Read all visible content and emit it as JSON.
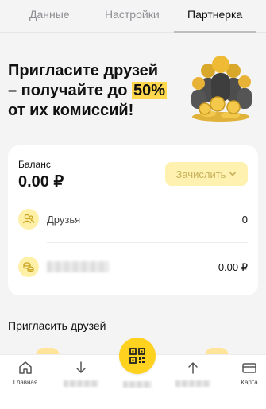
{
  "tabs": [
    {
      "label": "Данные"
    },
    {
      "label": "Настройки"
    },
    {
      "label": "Партнерка",
      "active": true
    }
  ],
  "hero": {
    "title_line1": "Пригласите друзей",
    "title_line2_prefix": "– получайте до ",
    "title_highlight": "50%",
    "title_line3": "от их комиссий!"
  },
  "balance": {
    "label": "Баланс",
    "value": "0.00 ₽",
    "credit_button": "Зачислить"
  },
  "rows": {
    "friends_label": "Друзья",
    "friends_value": "0",
    "earnings_value": "0.00 ₽"
  },
  "invite": {
    "title": "Пригласить друзей"
  },
  "nav": {
    "home_label": "Главная",
    "card_label": "Карта"
  },
  "colors": {
    "accent": "#ffd21f",
    "highlight": "#ffd84d",
    "icon_bg": "#fff0a8"
  }
}
